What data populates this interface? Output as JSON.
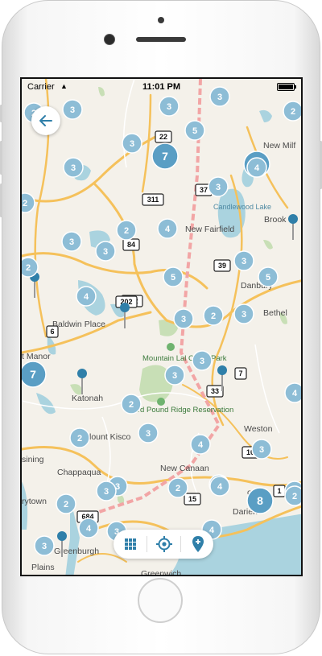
{
  "status_bar": {
    "carrier": "Carrier",
    "time": "11:01 PM"
  },
  "colors": {
    "cluster": "#8dbdd6",
    "cluster_large": "#5a9ec4",
    "pin": "#2f7fa9",
    "water": "#aad3df",
    "park": "#c8dfb6",
    "road": "#f5c15b"
  },
  "toolbar": {
    "buttons": [
      {
        "icon": "grid-icon"
      },
      {
        "icon": "locate-icon"
      },
      {
        "icon": "add-pin-icon"
      }
    ]
  },
  "map": {
    "places": {
      "new_milford": "New Milf",
      "candlewood_lake": "Candlewood Lake",
      "new_fairfield": "New Fairfield",
      "brookfield": "Brook",
      "danbury": "Danbury",
      "bethel": "Bethel",
      "baldwin_place": "Baldwin Place",
      "mountain_lakes": "Mountain Lal Camp Park",
      "ward_pound": "Ward Pound Ridge Reservation",
      "katonah": "Katonah",
      "mount_kisco": "lount Kisco",
      "chappaqua": "Chappaqua",
      "new_canaan": "New Canaan",
      "weston": "Weston",
      "norwalk": "orwa",
      "darien": "Darien",
      "greenburgh": "Greenburgh",
      "greenwich": "Greenwich",
      "manor": "t Manor",
      "ossining": "sining",
      "tarrytown": "rytown",
      "plains": "Plains"
    },
    "shields": [
      "22",
      "37",
      "311",
      "84",
      "39",
      "202",
      "6",
      "7",
      "33",
      "15",
      "1",
      "10",
      "202",
      "684"
    ],
    "clusters": [
      "3",
      "3",
      "2",
      "3",
      "7",
      "5",
      "3",
      "3",
      "7",
      "2",
      "2",
      "3",
      "4",
      "2",
      "3",
      "5",
      "2",
      "4",
      "5",
      "3",
      "2",
      "3",
      "7",
      "3",
      "3",
      "4",
      "2",
      "3",
      "4",
      "3",
      "2",
      "3",
      "4",
      "3",
      "2",
      "4",
      "2",
      "3",
      "4",
      "8",
      "2",
      "3",
      "3",
      "4",
      "3",
      "2",
      "3"
    ]
  }
}
